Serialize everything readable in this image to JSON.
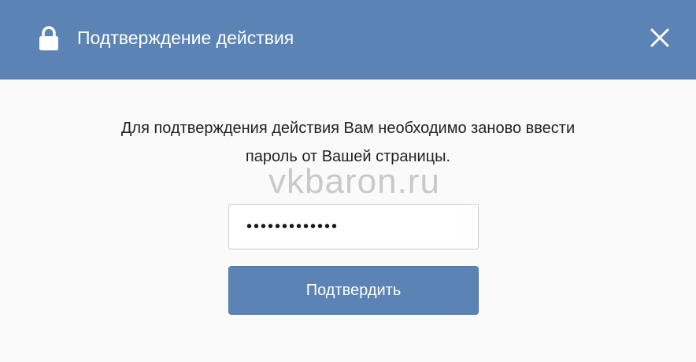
{
  "dialog": {
    "title": "Подтверждение действия",
    "message_line1": "Для подтверждения действия Вам необходимо заново ввести",
    "message_line2": "пароль от Вашей страницы.",
    "watermark": "vkbaron.ru",
    "password_value": "•••••••••••••",
    "confirm_label": "Подтвердить"
  },
  "icons": {
    "header_left": "lock-icon",
    "header_right": "close-icon"
  },
  "colors": {
    "header_bg": "#5b84b5",
    "button_bg": "#5b84b5",
    "body_bg": "#fafafa",
    "text": "#222222",
    "watermark": "#c9c9c9"
  }
}
